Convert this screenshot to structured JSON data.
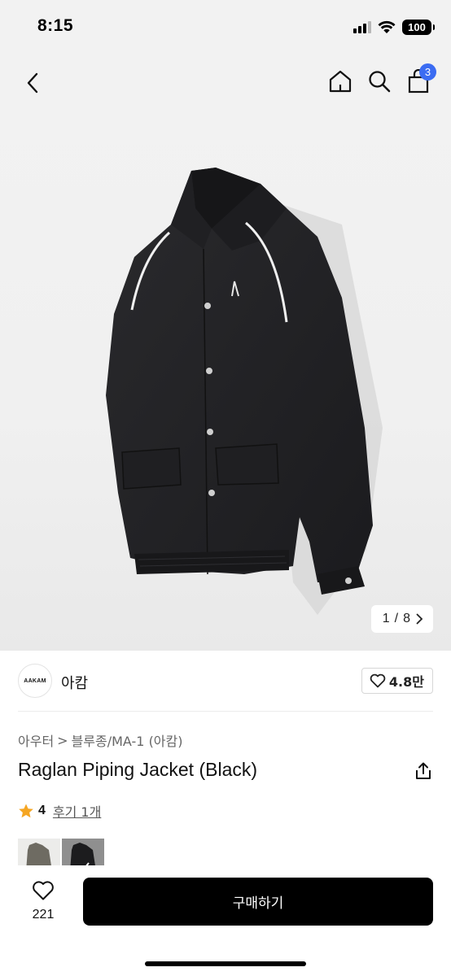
{
  "status_bar": {
    "time": "8:15",
    "battery": "100"
  },
  "nav": {
    "back_icon": "chevron-left-icon",
    "home_icon": "home-icon",
    "search_icon": "search-icon",
    "cart_icon": "shopping-bag-icon",
    "cart_count": "3"
  },
  "gallery": {
    "current": "1",
    "separator": "/",
    "total": "8",
    "next_icon": "chevron-right-icon"
  },
  "brand": {
    "logo_text": "AAKAM",
    "name": "아캄",
    "like_count": "4.8만"
  },
  "breadcrumb": {
    "category": "아우터",
    "separator": ">",
    "subcategory": "블루종/MA-1 (아캄)"
  },
  "product": {
    "title": "Raglan Piping Jacket (Black)",
    "rating": "4",
    "reviews": "후기 1개"
  },
  "bottom": {
    "wish_count": "221",
    "buy_label": "구매하기"
  },
  "colors": {
    "accent": "#3b6cf2",
    "star": "#f5a623",
    "buy_bg": "#000000"
  }
}
